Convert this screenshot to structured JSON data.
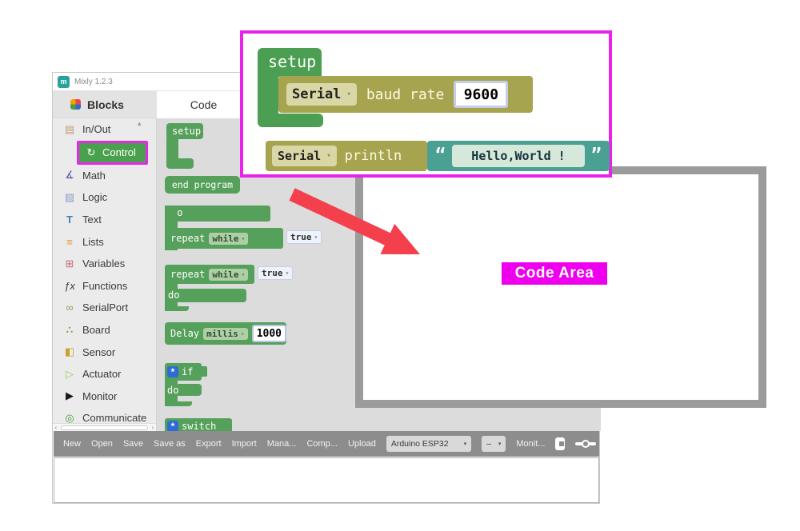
{
  "colors": {
    "accent_magenta": "#ee00ee",
    "block_green": "#55a05a",
    "block_olive": "#a6a44f",
    "block_teal": "#4aa093",
    "arrow_red": "#f4404d",
    "toolbar_gray": "#8d8d8d"
  },
  "window": {
    "title": "Mixly 1.2.3",
    "logo_glyph": "m"
  },
  "sidebar": {
    "header": "Blocks",
    "items": [
      {
        "label": "In/Out",
        "glyph": "▤"
      },
      {
        "label": "Control",
        "glyph": "↻"
      },
      {
        "label": "Math",
        "glyph": "∡"
      },
      {
        "label": "Logic",
        "glyph": "▨"
      },
      {
        "label": "Text",
        "glyph": "T"
      },
      {
        "label": "Lists",
        "glyph": "≡"
      },
      {
        "label": "Variables",
        "glyph": "⊞"
      },
      {
        "label": "Functions",
        "glyph": "ƒx"
      },
      {
        "label": "SerialPort",
        "glyph": "∞"
      },
      {
        "label": "Board",
        "glyph": "∴"
      },
      {
        "label": "Sensor",
        "glyph": "◧"
      },
      {
        "label": "Actuator",
        "glyph": "▷"
      },
      {
        "label": "Monitor",
        "glyph": "▶"
      },
      {
        "label": "Communicate",
        "glyph": "◎"
      }
    ]
  },
  "tabs": {
    "code": "Code"
  },
  "icons": {
    "dropdown_arrow": "▾",
    "gear": "*",
    "scroll_left": "‹",
    "scroll_right": "›",
    "scroll_up": "▴"
  },
  "palette": {
    "setup": "setup",
    "end_program": "end program",
    "do": "do",
    "repeat": "repeat",
    "while": "while",
    "true_value": "true",
    "delay": "Delay",
    "millis": "millis",
    "delay_value": "1000",
    "if": "if",
    "switch": "switch"
  },
  "callout": {
    "setup": "setup",
    "serial": "Serial",
    "baud_rate": "baud rate",
    "baud_value": "9600",
    "println": "println",
    "open_quote": "“",
    "close_quote": "”",
    "message": "Hello,World !"
  },
  "code_area": {
    "label": "Code Area"
  },
  "toolbar": {
    "buttons": [
      "New",
      "Open",
      "Save",
      "Save as",
      "Export",
      "Import",
      "Mana...",
      "Comp...",
      "Upload"
    ],
    "board_select": "Arduino ESP32",
    "port_select": "–",
    "monitor": "Monit..."
  }
}
